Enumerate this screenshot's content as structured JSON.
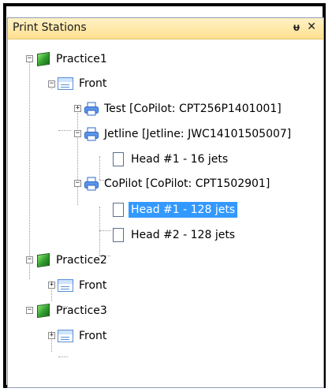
{
  "panel": {
    "title": "Print Stations",
    "pin_glyph": "ᵾ",
    "close_glyph": "✕"
  },
  "tree": {
    "practice1": "Practice1",
    "front1": "Front",
    "test": "Test [CoPilot: CPT256P1401001]",
    "jetline": "Jetline [Jetline: JWC14101505007]",
    "jetline_head1": "Head #1 - 16 jets",
    "copilot": "CoPilot [CoPilot: CPT1502901]",
    "copilot_head1": "Head #1 - 128 jets",
    "copilot_head2": "Head #2 - 128 jets",
    "practice2": "Practice2",
    "front2": "Front",
    "practice3": "Practice3",
    "front3": "Front"
  },
  "icons": {
    "station": "station-icon",
    "front": "front-icon",
    "printer": "printer-icon",
    "head": "head-icon"
  },
  "colors": {
    "selection": "#3399ff",
    "titlebar": "#ffe08f"
  }
}
